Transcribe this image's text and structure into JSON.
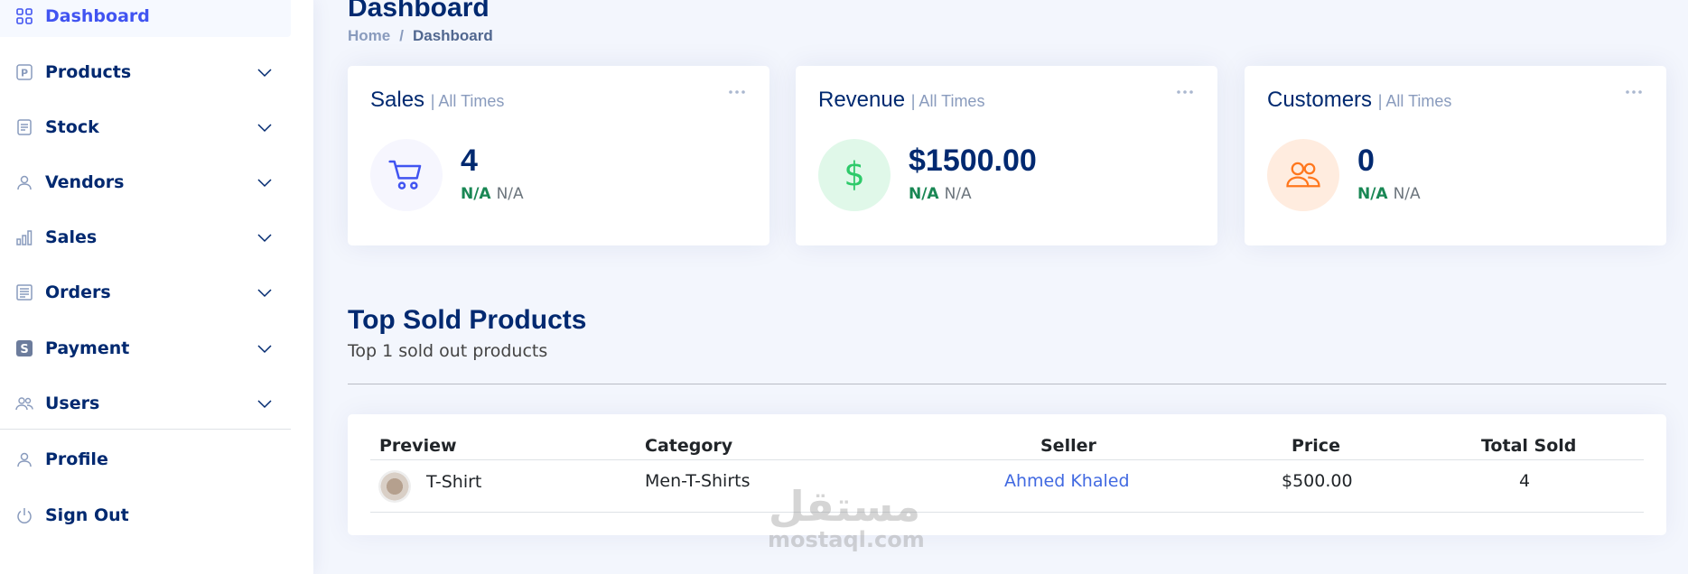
{
  "sidebar": {
    "items": [
      {
        "label": "Dashboard",
        "icon": "grid-icon"
      },
      {
        "label": "Products",
        "icon": "product-p-icon"
      },
      {
        "label": "Stock",
        "icon": "list-icon"
      },
      {
        "label": "Vendors",
        "icon": "person-icon"
      },
      {
        "label": "Sales",
        "icon": "bar-chart-icon"
      },
      {
        "label": "Orders",
        "icon": "layout-text-icon"
      },
      {
        "label": "Payment",
        "icon": "payment-s-icon"
      },
      {
        "label": "Users",
        "icon": "people-icon"
      },
      {
        "label": "Profile",
        "icon": "person-icon"
      },
      {
        "label": "Sign Out",
        "icon": "power-icon"
      }
    ]
  },
  "header": {
    "title": "Dashboard",
    "breadcrumb": {
      "home": "Home",
      "separator": "/",
      "current": "Dashboard"
    }
  },
  "cards": [
    {
      "title": "Sales",
      "period": "| All Times",
      "value": "4",
      "change": "N/A",
      "change_label": "N/A",
      "icon": "cart-icon",
      "icon_color": "#4154f1",
      "icon_bg": "#f6f6fe"
    },
    {
      "title": "Revenue",
      "period": "| All Times",
      "value": "$1500.00",
      "change": "N/A",
      "change_label": "N/A",
      "icon": "dollar-icon",
      "icon_color": "#2eca6a",
      "icon_bg": "#e0f8e9"
    },
    {
      "title": "Customers",
      "period": "| All Times",
      "value": "0",
      "change": "N/A",
      "change_label": "N/A",
      "icon": "people-icon",
      "icon_color": "#ff771d",
      "icon_bg": "#ffecdf"
    }
  ],
  "top_products": {
    "title": "Top Sold Products",
    "subtitle": "Top 1 sold out products",
    "columns": [
      "Preview",
      "Category",
      "Seller",
      "Price",
      "Total Sold"
    ],
    "rows": [
      {
        "name": "T-Shirt",
        "category": "Men-T-Shirts",
        "seller": "Ahmed Khaled",
        "price": "$500.00",
        "total_sold": "4"
      }
    ]
  },
  "watermark": {
    "arabic": "مستقل",
    "latin": "mostaql.com"
  }
}
